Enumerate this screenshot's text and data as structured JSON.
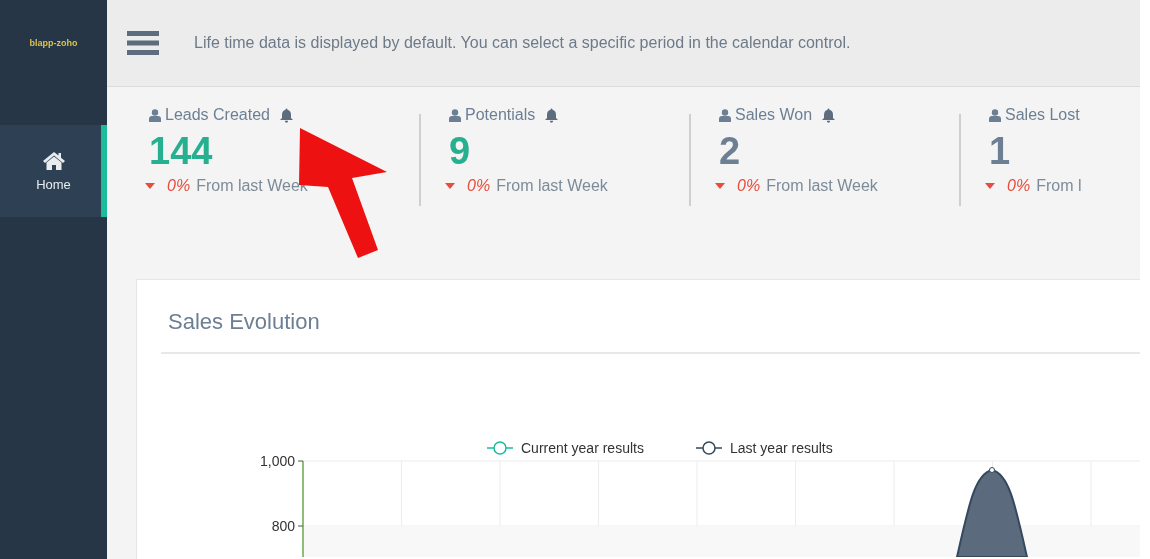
{
  "sidebar": {
    "logo": "blapp-zoho",
    "items": [
      {
        "label": "Home",
        "selected": true
      }
    ]
  },
  "top_bar": {
    "message": "Life time data is displayed by default. You can select a specific period in the calendar control."
  },
  "stats": [
    {
      "label": "Leads Created",
      "value": "144",
      "color": "#26b08f",
      "change": "0%",
      "change_text": "From last Week"
    },
    {
      "label": "Potentials",
      "value": "9",
      "color": "#26b08f",
      "change": "0%",
      "change_text": "From last Week"
    },
    {
      "label": "Sales Won",
      "value": "2",
      "color": "#6c7f93",
      "change": "0%",
      "change_text": "From last Week"
    },
    {
      "label": "Sales Lost",
      "value": "1",
      "color": "#6c7f93",
      "change": "0%",
      "change_text": "From l"
    }
  ],
  "sales_evolution": {
    "title": "Sales Evolution",
    "chart": {
      "y_labels": [
        "1,000",
        "800"
      ],
      "legend": [
        {
          "label": "Current year results",
          "color": "#1abc9c"
        },
        {
          "label": "Last year results",
          "color": "#34495e"
        }
      ]
    }
  }
}
